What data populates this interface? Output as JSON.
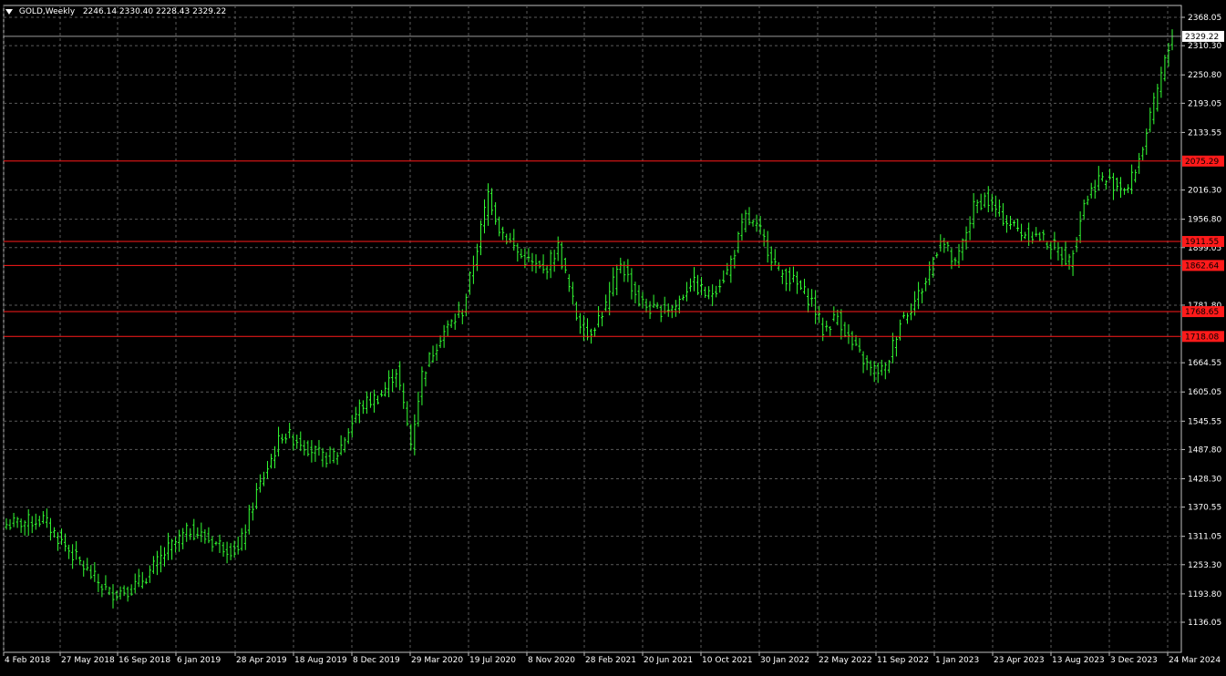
{
  "symbol": {
    "name": "GOLD,Weekly",
    "ohlc": "2246.14 2330.40 2228.43 2329.22"
  },
  "colors": {
    "background": "#000000",
    "axis": "#c0c0c0",
    "grid": "#5a5a5a",
    "candle": "#33ff33",
    "level": "#ff1a1a",
    "text": "#ffffff"
  },
  "current_price": "2329.22",
  "chart_data": {
    "type": "candlestick",
    "title": "GOLD,Weekly",
    "ylim": [
      1136.05,
      2368.05
    ],
    "y_ticks": [
      "2368.05",
      "2310.30",
      "2250.80",
      "2193.05",
      "2133.55",
      "2016.30",
      "1956.80",
      "1899.05",
      "1781.80",
      "1664.55",
      "1605.05",
      "1545.55",
      "1487.80",
      "1428.30",
      "1370.55",
      "1311.05",
      "1253.30",
      "1193.80",
      "1136.05"
    ],
    "x_ticks": [
      "4 Feb 2018",
      "27 May 2018",
      "16 Sep 2018",
      "6 Jan 2019",
      "28 Apr 2019",
      "18 Aug 2019",
      "8 Dec 2019",
      "29 Mar 2020",
      "19 Jul 2020",
      "8 Nov 2020",
      "28 Feb 2021",
      "20 Jun 2021",
      "10 Oct 2021",
      "30 Jan 2022",
      "22 May 2022",
      "11 Sep 2022",
      "1 Jan 2023",
      "23 Apr 2023",
      "13 Aug 2023",
      "3 Dec 2023",
      "24 Mar 2024"
    ],
    "levels": [
      "2075.29",
      "1911.55",
      "1862.64",
      "1768.65",
      "1718.08"
    ],
    "close_series": [
      {
        "week": 0,
        "close": 1335
      },
      {
        "week": 10,
        "close": 1345
      },
      {
        "week": 15,
        "close": 1300
      },
      {
        "week": 22,
        "close": 1240
      },
      {
        "week": 28,
        "close": 1195
      },
      {
        "week": 34,
        "close": 1205
      },
      {
        "week": 38,
        "close": 1230
      },
      {
        "week": 44,
        "close": 1285
      },
      {
        "week": 50,
        "close": 1325
      },
      {
        "week": 56,
        "close": 1300
      },
      {
        "week": 63,
        "close": 1280
      },
      {
        "week": 68,
        "close": 1400
      },
      {
        "week": 75,
        "close": 1520
      },
      {
        "week": 80,
        "close": 1505
      },
      {
        "week": 86,
        "close": 1470
      },
      {
        "week": 90,
        "close": 1480
      },
      {
        "week": 96,
        "close": 1575
      },
      {
        "week": 102,
        "close": 1600
      },
      {
        "week": 106,
        "close": 1650
      },
      {
        "week": 110,
        "close": 1500
      },
      {
        "week": 113,
        "close": 1640
      },
      {
        "week": 118,
        "close": 1720
      },
      {
        "week": 124,
        "close": 1770
      },
      {
        "week": 128,
        "close": 1900
      },
      {
        "week": 131,
        "close": 2010
      },
      {
        "week": 134,
        "close": 1940
      },
      {
        "week": 140,
        "close": 1880
      },
      {
        "week": 146,
        "close": 1850
      },
      {
        "week": 150,
        "close": 1900
      },
      {
        "week": 155,
        "close": 1760
      },
      {
        "week": 158,
        "close": 1720
      },
      {
        "week": 163,
        "close": 1780
      },
      {
        "week": 167,
        "close": 1870
      },
      {
        "week": 172,
        "close": 1790
      },
      {
        "week": 176,
        "close": 1770
      },
      {
        "week": 182,
        "close": 1780
      },
      {
        "week": 186,
        "close": 1830
      },
      {
        "week": 191,
        "close": 1800
      },
      {
        "week": 196,
        "close": 1850
      },
      {
        "week": 201,
        "close": 1960
      },
      {
        "week": 205,
        "close": 1930
      },
      {
        "week": 210,
        "close": 1850
      },
      {
        "week": 214,
        "close": 1830
      },
      {
        "week": 219,
        "close": 1790
      },
      {
        "week": 222,
        "close": 1730
      },
      {
        "week": 226,
        "close": 1760
      },
      {
        "week": 230,
        "close": 1700
      },
      {
        "week": 235,
        "close": 1650
      },
      {
        "week": 239,
        "close": 1650
      },
      {
        "week": 243,
        "close": 1750
      },
      {
        "week": 247,
        "close": 1790
      },
      {
        "week": 250,
        "close": 1830
      },
      {
        "week": 254,
        "close": 1920
      },
      {
        "week": 258,
        "close": 1860
      },
      {
        "week": 263,
        "close": 1980
      },
      {
        "week": 266,
        "close": 2000
      },
      {
        "week": 271,
        "close": 1960
      },
      {
        "week": 276,
        "close": 1930
      },
      {
        "week": 281,
        "close": 1920
      },
      {
        "week": 285,
        "close": 1900
      },
      {
        "week": 289,
        "close": 1870
      },
      {
        "week": 293,
        "close": 1990
      },
      {
        "week": 297,
        "close": 2040
      },
      {
        "week": 301,
        "close": 2030
      },
      {
        "week": 305,
        "close": 2020
      },
      {
        "week": 308,
        "close": 2080
      },
      {
        "week": 311,
        "close": 2160
      },
      {
        "week": 314,
        "close": 2250
      },
      {
        "week": 317,
        "close": 2329.22
      }
    ]
  }
}
